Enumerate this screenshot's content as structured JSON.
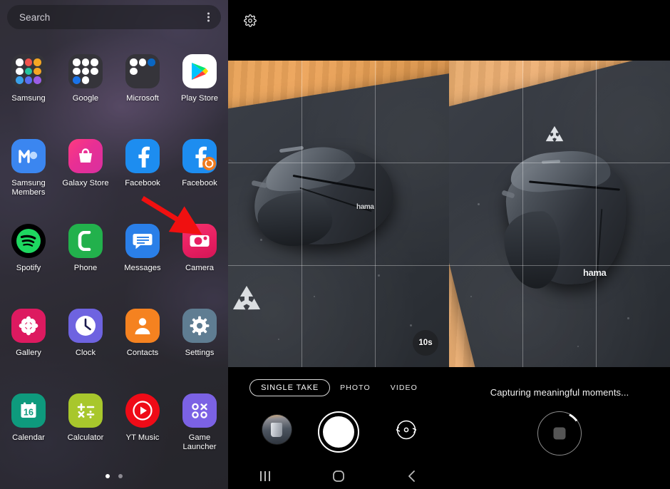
{
  "drawer": {
    "search": {
      "placeholder": "Search",
      "more_icon": "kebab-menu-icon"
    },
    "apps": [
      {
        "label": "Samsung",
        "icon": "folder-samsung-icon",
        "type": "folder",
        "mini": [
          "#ffffff",
          "#f0544d",
          "#f5a623",
          "#ffffff",
          "#25c4a0",
          "#f5a623",
          "#3aa0e8",
          "#5a6ff0",
          "#9b5de5"
        ]
      },
      {
        "label": "Google",
        "icon": "folder-google-icon",
        "type": "folder",
        "mini": [
          "#ffffff",
          "#ffffff",
          "#ffffff",
          "#ffffff",
          "#ffffff",
          "#ffffff",
          "#1a73e8",
          "#ffffff",
          ""
        ]
      },
      {
        "label": "Microsoft",
        "icon": "folder-microsoft-icon",
        "type": "folder",
        "mini": [
          "#e84a23",
          "#3aa0e8",
          "#0a66c2",
          "#0f6cbd",
          "",
          "",
          "",
          "",
          ""
        ]
      },
      {
        "label": "Play Store",
        "icon": "play-store-icon",
        "type": "app"
      },
      {
        "label": "Samsung Members",
        "icon": "samsung-members-icon",
        "type": "app"
      },
      {
        "label": "Galaxy Store",
        "icon": "galaxy-store-icon",
        "type": "app"
      },
      {
        "label": "Facebook",
        "icon": "facebook-icon",
        "type": "app"
      },
      {
        "label": "Facebook",
        "icon": "facebook-badge-icon",
        "type": "app"
      },
      {
        "label": "Spotify",
        "icon": "spotify-icon",
        "type": "app"
      },
      {
        "label": "Phone",
        "icon": "phone-icon",
        "type": "app"
      },
      {
        "label": "Messages",
        "icon": "messages-icon",
        "type": "app"
      },
      {
        "label": "Camera",
        "icon": "camera-icon",
        "type": "app"
      },
      {
        "label": "Gallery",
        "icon": "gallery-icon",
        "type": "app"
      },
      {
        "label": "Clock",
        "icon": "clock-icon",
        "type": "app"
      },
      {
        "label": "Contacts",
        "icon": "contacts-icon",
        "type": "app"
      },
      {
        "label": "Settings",
        "icon": "settings-gear-icon",
        "type": "app"
      },
      {
        "label": "Calendar",
        "icon": "calendar-icon",
        "type": "app",
        "day": "16"
      },
      {
        "label": "Calculator",
        "icon": "calculator-icon",
        "type": "app"
      },
      {
        "label": "YT Music",
        "icon": "youtube-music-icon",
        "type": "app"
      },
      {
        "label": "Game Launcher",
        "icon": "game-launcher-icon",
        "type": "app"
      }
    ],
    "pages": {
      "count": 2,
      "active": 1
    },
    "annotation": {
      "type": "arrow",
      "color": "#f01010",
      "points_to": "Camera"
    }
  },
  "camera_viewfinder": {
    "settings_icon": "settings-gear-icon",
    "grid_overlay": true,
    "timer_badge": "10s",
    "scene": {
      "subject": "computer mouse on mousepad",
      "brand_text": "hama",
      "mark": "recycle-symbol"
    },
    "modes": [
      {
        "label": "SINGLE TAKE",
        "selected": true
      },
      {
        "label": "PHOTO",
        "selected": false
      },
      {
        "label": "VIDEO",
        "selected": false
      }
    ],
    "controls": {
      "gallery_thumb": "gallery-thumbnail",
      "shutter": "shutter-button",
      "flip": "switch-camera-icon"
    },
    "navbar": [
      {
        "icon": "recents-icon"
      },
      {
        "icon": "home-icon"
      },
      {
        "icon": "back-icon"
      }
    ]
  },
  "camera_capturing": {
    "status_text": "Capturing meaningful moments...",
    "grid_overlay": true,
    "scene": {
      "subject": "computer mouse on mousepad",
      "brand_text": "hama",
      "mark": "recycle-symbol"
    },
    "stop_button": "stop-capture-button"
  },
  "colors": {
    "accent_red": "#f01010",
    "camera_pink": "#e81f62",
    "drawer_bg": "#2e2d33",
    "camera_bg": "#000000"
  }
}
